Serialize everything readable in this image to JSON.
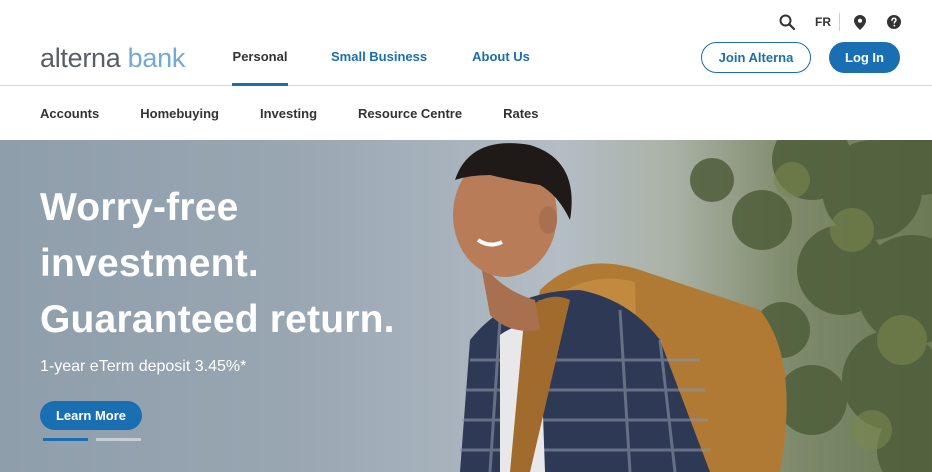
{
  "brand": {
    "logo_part1": "alterna",
    "logo_part2": "bank"
  },
  "utility": {
    "language": "FR",
    "icons": [
      "search-icon",
      "location-pin-icon",
      "help-icon"
    ]
  },
  "main_nav": {
    "tabs": [
      {
        "label": "Personal",
        "active": true
      },
      {
        "label": "Small Business",
        "active": false
      },
      {
        "label": "About Us",
        "active": false
      }
    ]
  },
  "actions": {
    "join_label": "Join Alterna",
    "login_label": "Log In"
  },
  "sub_nav": {
    "items": [
      "Accounts",
      "Homebuying",
      "Investing",
      "Resource Centre",
      "Rates"
    ]
  },
  "hero": {
    "title_lines": [
      "Worry-free",
      "investment.",
      "Guaranteed return."
    ],
    "subtitle": "1-year eTerm deposit 3.45%*",
    "cta_label": "Learn More",
    "slides": {
      "count": 2,
      "active_index": 0
    }
  },
  "colors": {
    "accent": "#1a6fb2",
    "logo_gray": "#5a5f66",
    "logo_blue": "#74a9d6",
    "text": "#333333"
  }
}
